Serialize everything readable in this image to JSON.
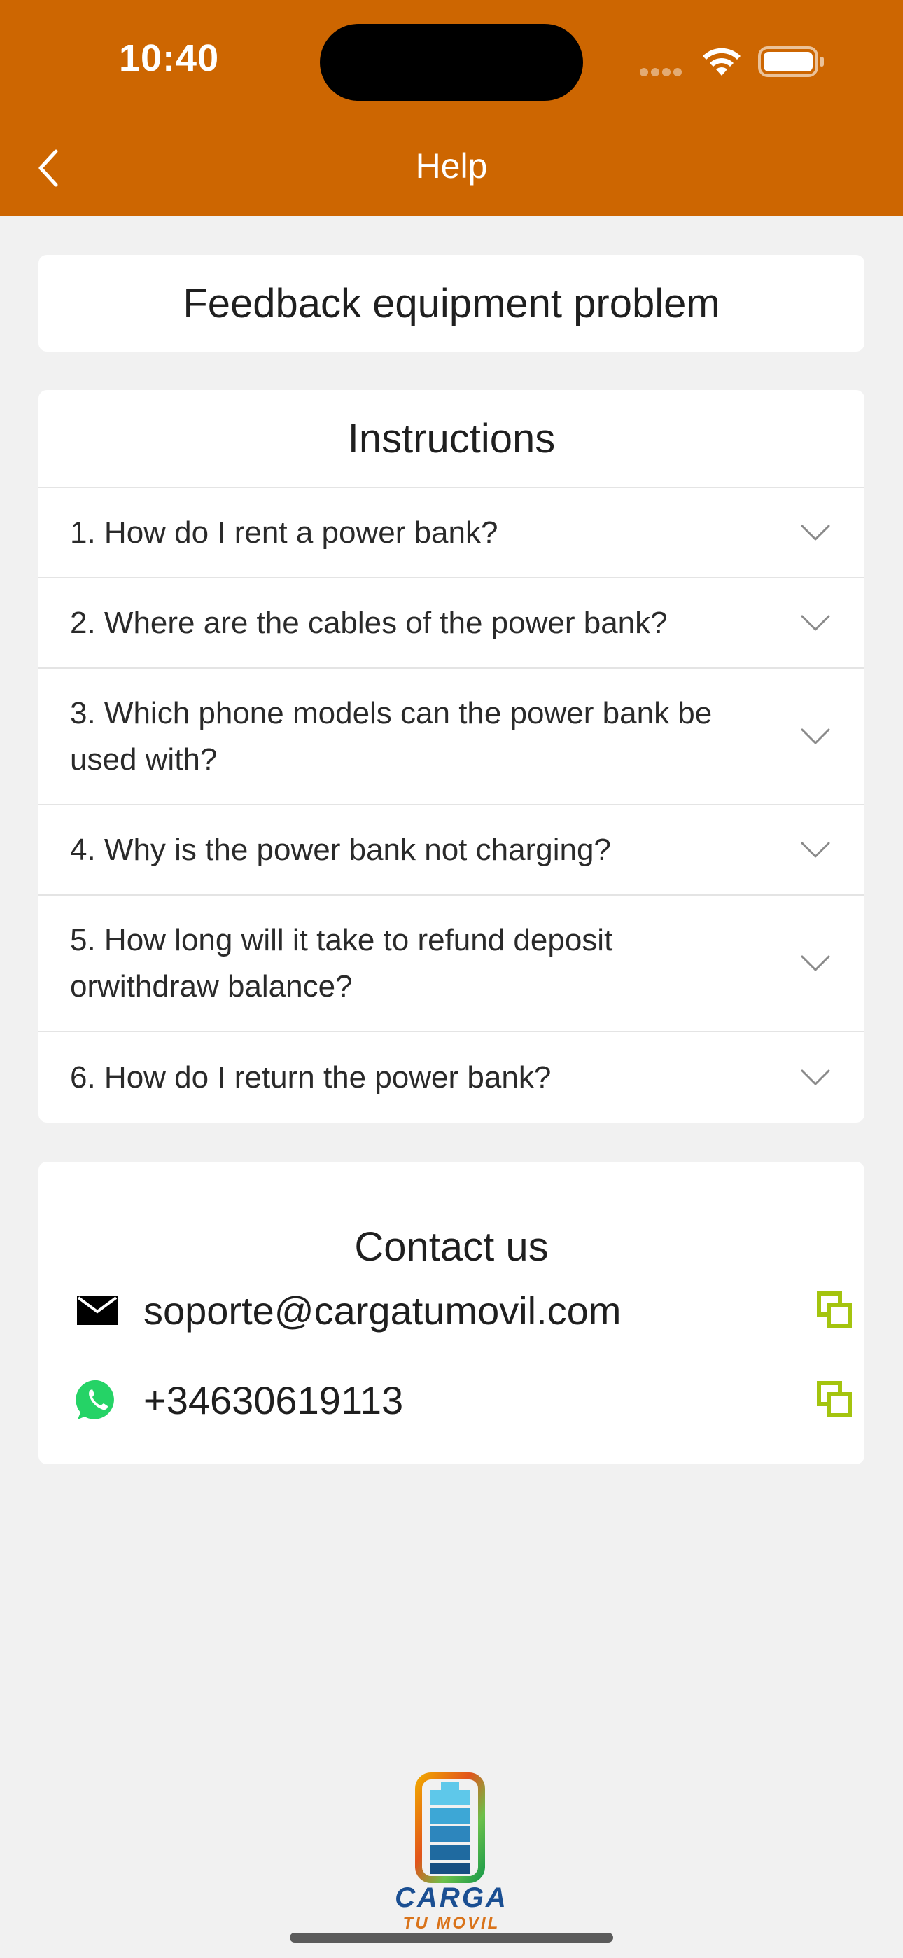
{
  "status_bar": {
    "time": "10:40"
  },
  "header": {
    "title": "Help",
    "background": "#cd6601"
  },
  "feedback": {
    "label": "Feedback equipment problem"
  },
  "instructions": {
    "title": "Instructions",
    "items": [
      {
        "label": "1. How do I rent a power bank?"
      },
      {
        "label": "2. Where are the cables of the power bank?"
      },
      {
        "label": "3. Which phone models can the power bank be used with?"
      },
      {
        "label": "4. Why is the power bank not charging?"
      },
      {
        "label": "5. How long will it take to refund deposit orwithdraw balance?"
      },
      {
        "label": "6. How do I return the power bank?"
      }
    ]
  },
  "contact": {
    "title": "Contact us",
    "email": "soporte@cargatumovil.com",
    "phone": "+34630619113",
    "copy_color": "#a4c40e",
    "whatsapp_color": "#25d366"
  },
  "logo": {
    "line1": "CARGA",
    "line2": "TU MOVIL"
  }
}
